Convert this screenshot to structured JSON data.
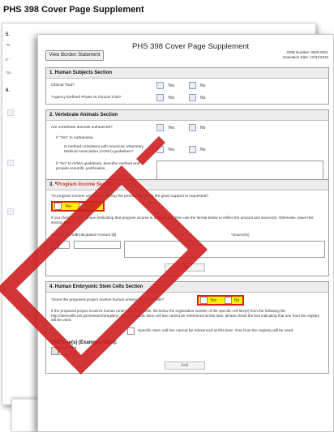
{
  "page_title": "PHS 398 Cover Page Supplement",
  "back_page": {
    "numbers": [
      "5.",
      "6."
    ],
    "snippets": [
      "*In",
      "If \"",
      "*Sc"
    ]
  },
  "form": {
    "burden_button": "View Burden Statement",
    "title": "PHS 398 Cover Page Supplement",
    "omb_number": "OMB Number: 0925-0001",
    "expiration": "Expiration Date: 10/31/2018",
    "yes": "Yes",
    "no": "No",
    "add": "Add",
    "s1": {
      "title": "1. Human Subjects Section",
      "q1": "Clinical Trial?",
      "q2": "*Agency-Defined Phase III Clinical Trial?"
    },
    "s2": {
      "title": "2. Vertebrate Animals Section",
      "q1": "Are vertebrate animals euthanized?",
      "q2": "If \"Yes\" to euthanasia",
      "q3": "Is method consistent with American Veterinary Medical Association (AVMA) guidelines?",
      "q4": "If \"No\" to AVMA guidelines, describe method and provide scientific justification"
    },
    "s3": {
      "star": "3. *",
      "title": "Program Income Section",
      "q1": "*Is program income anticipated during the periods for which the grant support is requested?",
      "note": "If you checked \"yes\" above (indicating that program income is anticipated), then use the format below to reflect the amount and source(s). Otherwise, leave this section blank.",
      "col1": "*Budget Period",
      "col2": "*Anticipated Amount ($)",
      "col3": "*Source(s)"
    },
    "s4": {
      "title": "4. Human Embryonic Stem Cells Section",
      "q1": "*Does the proposed project involve human embryonic stem cells?",
      "note": "If the proposed project involves human embryonic stem cells, list below the registration number of the specific cell line(s) from the following list: http://stemcells.nih.gov/research/registry/. Or, if a specific stem cell line cannot be referenced at this time, please check the box indicating that one from the registry will be used:",
      "check_label": "Specific stem cell line cannot be referenced at this time. One from the registry will be used.",
      "cell_lines": "Cell Line(s) (Example: 0004):"
    }
  },
  "colors": {
    "highlight_fill": "#fff200",
    "highlight_border": "#e41b17",
    "watermark": "#cc1f1f"
  }
}
